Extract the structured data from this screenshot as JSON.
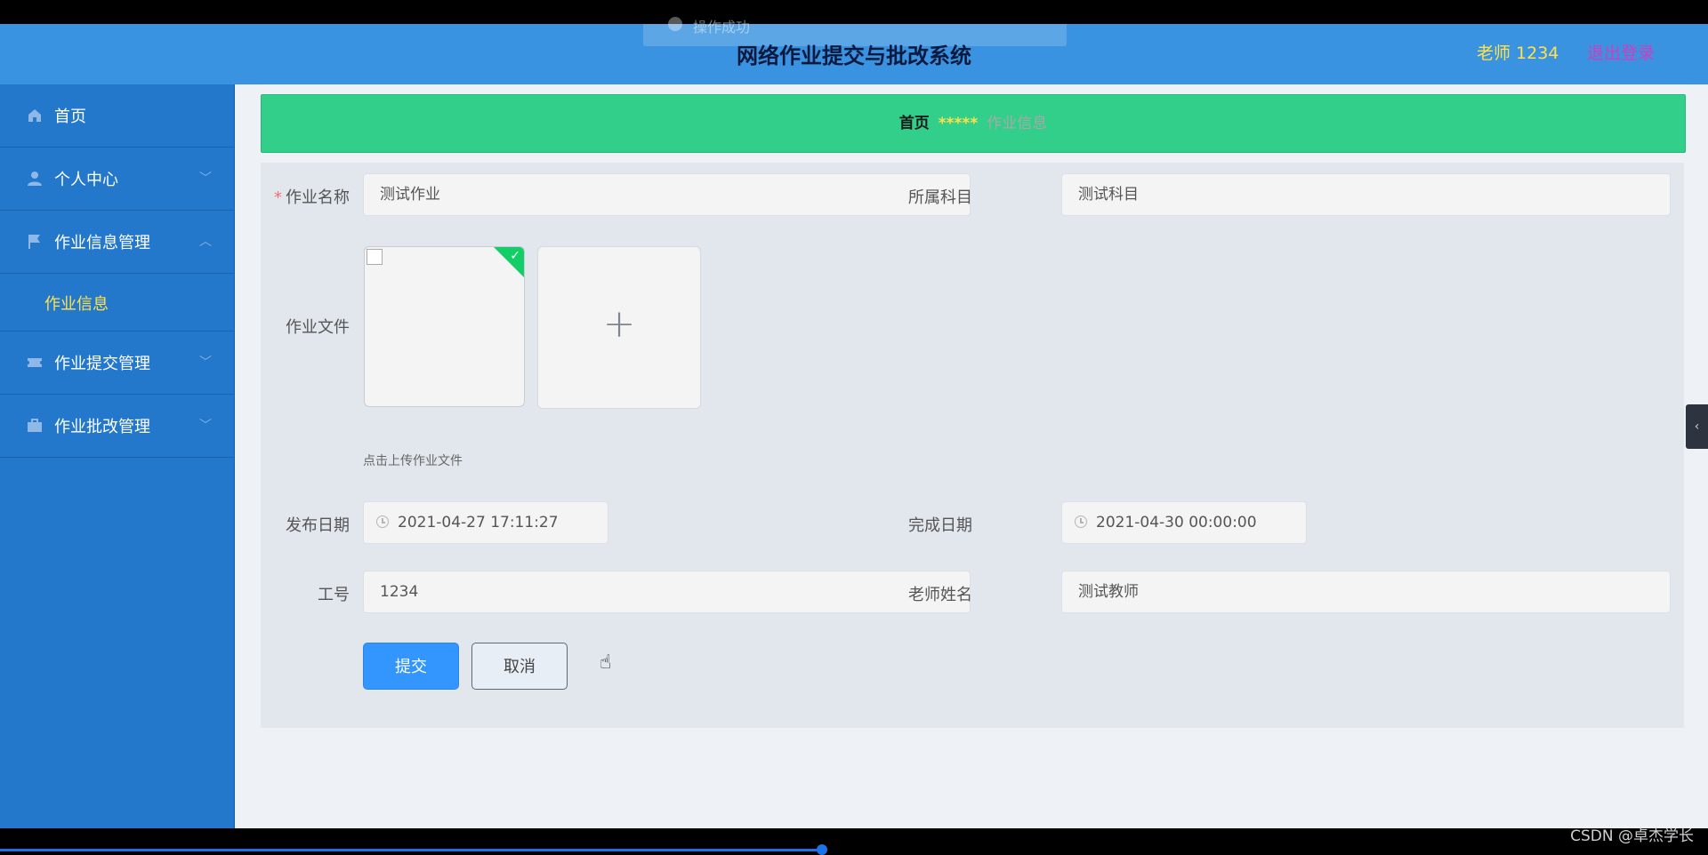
{
  "header": {
    "title": "网络作业提交与批改系统",
    "user": "老师 1234",
    "logout": "退出登录",
    "toast": "操作成功"
  },
  "sidebar": {
    "items": [
      {
        "label": "首页",
        "icon": "home-icon"
      },
      {
        "label": "个人中心",
        "icon": "user-icon"
      },
      {
        "label": "作业信息管理",
        "icon": "flag-icon"
      },
      {
        "label": "作业提交管理",
        "icon": "ticket-icon"
      },
      {
        "label": "作业批改管理",
        "icon": "briefcase-icon"
      }
    ],
    "subitem": "作业信息"
  },
  "breadcrumb": {
    "home": "首页",
    "separator": "*****",
    "current": "作业信息"
  },
  "form": {
    "name_label": "作业名称",
    "name_value": "测试作业",
    "subject_label": "所属科目",
    "subject_value": "测试科目",
    "file_label": "作业文件",
    "upload_hint": "点击上传作业文件",
    "publish_label": "发布日期",
    "publish_value": "2021-04-27 17:11:27",
    "due_label": "完成日期",
    "due_value": "2021-04-30 00:00:00",
    "id_label": "工号",
    "id_value": "1234",
    "teacher_label": "老师姓名",
    "teacher_value": "测试教师",
    "submit": "提交",
    "cancel": "取消"
  },
  "watermark": "CSDN @卓杰学长",
  "colors": {
    "header": "#3a93e0",
    "sidebar": "#2478cc",
    "breadcrumb": "#31cf8a",
    "accent_yellow": "#ffe14d",
    "logout": "#d33cbf",
    "primary": "#3396ff"
  }
}
